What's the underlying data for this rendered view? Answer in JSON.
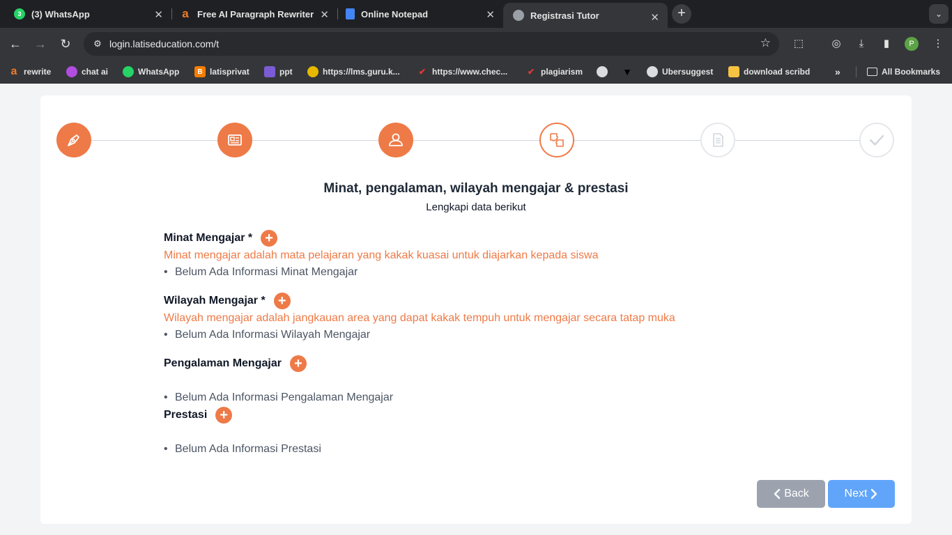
{
  "browser": {
    "tabs": [
      {
        "title": "(3) WhatsApp",
        "icon": "whatsapp-icon",
        "badge": "3",
        "active": false
      },
      {
        "title": "Free AI Paragraph Rewriter",
        "icon": "rewriter-icon",
        "active": false
      },
      {
        "title": "Online Notepad",
        "icon": "notepad-icon",
        "active": false
      },
      {
        "title": "Registrasi Tutor",
        "icon": "globe-icon",
        "active": true
      }
    ],
    "url": "login.latiseducation.com/t",
    "profile_initial": "P",
    "bookmarks": [
      {
        "label": "rewrite",
        "icon": "rewriter-icon"
      },
      {
        "label": "chat ai",
        "icon": "chat-ai-icon"
      },
      {
        "label": "WhatsApp",
        "icon": "whatsapp-icon"
      },
      {
        "label": "latisprivat",
        "icon": "blogger-icon"
      },
      {
        "label": "ppt",
        "icon": "ppt-icon"
      },
      {
        "label": "https://lms.guru.k...",
        "icon": "lms-icon"
      },
      {
        "label": "https://www.chec...",
        "icon": "checkmark-icon"
      },
      {
        "label": "plagiarism",
        "icon": "checkmark-icon"
      },
      {
        "label": "",
        "icon": "globe-icon"
      },
      {
        "label": "",
        "icon": "shirt-icon"
      },
      {
        "label": "Ubersuggest",
        "icon": "globe-icon"
      },
      {
        "label": "download scribd",
        "icon": "scribd-icon"
      }
    ],
    "all_bookmarks": "All Bookmarks"
  },
  "stepper": {
    "steps": [
      {
        "icon": "pen-icon",
        "status": "done"
      },
      {
        "icon": "id-card-icon",
        "status": "done"
      },
      {
        "icon": "user-icon",
        "status": "done"
      },
      {
        "icon": "puzzle-icon",
        "status": "current"
      },
      {
        "icon": "document-icon",
        "status": "todo"
      },
      {
        "icon": "checkmark-icon",
        "status": "todo"
      }
    ]
  },
  "form": {
    "title": "Minat, pengalaman, wilayah mengajar & prestasi",
    "subtitle": "Lengkapi data berikut",
    "sections": [
      {
        "title": "Minat Mengajar *",
        "hint": "Minat mengajar adalah mata pelajaran yang kakak kuasai untuk diajarkan kepada siswa",
        "empty": "Belum Ada Informasi Minat Mengajar"
      },
      {
        "title": "Wilayah Mengajar *",
        "hint": "Wilayah mengajar adalah jangkauan area yang dapat kakak tempuh untuk mengajar secara tatap muka",
        "empty": "Belum Ada Informasi Wilayah Mengajar"
      },
      {
        "title": "Pengalaman Mengajar",
        "hint": "",
        "empty": "Belum Ada Informasi Pengalaman Mengajar"
      },
      {
        "title": "Prestasi",
        "hint": "",
        "empty": "Belum Ada Informasi Prestasi"
      }
    ],
    "add_symbol": "+",
    "back_label": "Back",
    "next_label": "Next"
  },
  "colors": {
    "accent": "#ee7a47",
    "back_button": "#9ca3af",
    "next_button": "#60a5fa"
  }
}
